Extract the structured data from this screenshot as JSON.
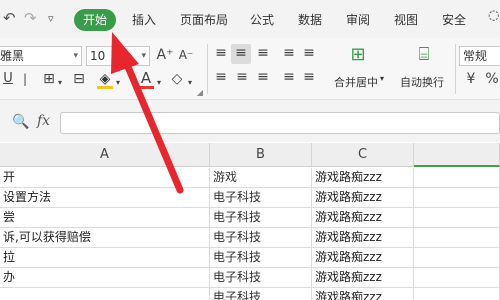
{
  "ribbon": {
    "tabs": [
      {
        "label": "开始"
      },
      {
        "label": "插入"
      },
      {
        "label": "页面布局"
      },
      {
        "label": "公式"
      },
      {
        "label": "数据"
      },
      {
        "label": "审阅"
      },
      {
        "label": "视图"
      },
      {
        "label": "安全"
      }
    ],
    "active_tab": "开始"
  },
  "toolbar": {
    "font_name": "雅黑",
    "font_size": "10",
    "merge_center_label": "合并居中",
    "wrap_text_label": "自动换行",
    "number_format": "常规"
  },
  "formula_bar": {
    "fx_label": "fx",
    "value": ""
  },
  "sheet": {
    "columns": [
      "A",
      "B",
      "C"
    ],
    "rows": [
      {
        "a": "开",
        "b": "游戏",
        "c": "游戏路痴zzz"
      },
      {
        "a": "设置方法",
        "b": "电子科技",
        "c": "游戏路痴zzz"
      },
      {
        "a": "尝",
        "b": "电子科技",
        "c": "游戏路痴zzz"
      },
      {
        "a": "诉,可以获得赔偿",
        "b": "电子科技",
        "c": "游戏路痴zzz"
      },
      {
        "a": "拉",
        "b": "电子科技",
        "c": "游戏路痴zzz"
      },
      {
        "a": "办",
        "b": "电子科技",
        "c": "游戏路痴zzz"
      },
      {
        "a": "",
        "b": "电子科技",
        "c": "游戏路痴zzz"
      }
    ]
  },
  "colors": {
    "active_tab": "#3a9c4a",
    "arrow": "#e8262d",
    "selected_column": "#43a047"
  }
}
